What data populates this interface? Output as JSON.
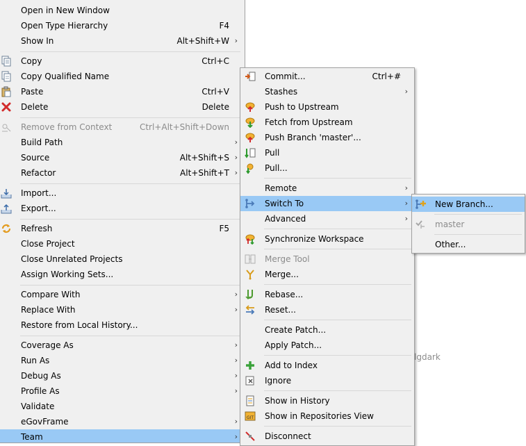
{
  "background_fragment": "lgdark",
  "context_menu": {
    "items": [
      {
        "label": "Open in New Window"
      },
      {
        "label": "Open Type Hierarchy",
        "shortcut": "F4"
      },
      {
        "label": "Show In",
        "shortcut": "Alt+Shift+W"
      },
      {
        "label": "Copy",
        "shortcut": "Ctrl+C"
      },
      {
        "label": "Copy Qualified Name"
      },
      {
        "label": "Paste",
        "shortcut": "Ctrl+V"
      },
      {
        "label": "Delete",
        "shortcut": "Delete"
      },
      {
        "label": "Remove from Context",
        "shortcut": "Ctrl+Alt+Shift+Down"
      },
      {
        "label": "Build Path"
      },
      {
        "label": "Source",
        "shortcut": "Alt+Shift+S"
      },
      {
        "label": "Refactor",
        "shortcut": "Alt+Shift+T"
      },
      {
        "label": "Import..."
      },
      {
        "label": "Export..."
      },
      {
        "label": "Refresh",
        "shortcut": "F5"
      },
      {
        "label": "Close Project"
      },
      {
        "label": "Close Unrelated Projects"
      },
      {
        "label": "Assign Working Sets..."
      },
      {
        "label": "Compare With"
      },
      {
        "label": "Replace With"
      },
      {
        "label": "Restore from Local History..."
      },
      {
        "label": "Coverage As"
      },
      {
        "label": "Run As"
      },
      {
        "label": "Debug As"
      },
      {
        "label": "Profile As"
      },
      {
        "label": "Validate"
      },
      {
        "label": "eGovFrame"
      },
      {
        "label": "Team"
      }
    ]
  },
  "team_menu": {
    "items": [
      {
        "label": "Commit...",
        "shortcut": "Ctrl+#"
      },
      {
        "label": "Stashes"
      },
      {
        "label": "Push to Upstream"
      },
      {
        "label": "Fetch from Upstream"
      },
      {
        "label": "Push Branch 'master'..."
      },
      {
        "label": "Pull"
      },
      {
        "label": "Pull..."
      },
      {
        "label": "Remote"
      },
      {
        "label": "Switch To"
      },
      {
        "label": "Advanced"
      },
      {
        "label": "Synchronize Workspace"
      },
      {
        "label": "Merge Tool"
      },
      {
        "label": "Merge..."
      },
      {
        "label": "Rebase..."
      },
      {
        "label": "Reset..."
      },
      {
        "label": "Create Patch..."
      },
      {
        "label": "Apply Patch..."
      },
      {
        "label": "Add to Index"
      },
      {
        "label": "Ignore"
      },
      {
        "label": "Show in History"
      },
      {
        "label": "Show in Repositories View"
      },
      {
        "label": "Disconnect"
      }
    ]
  },
  "switch_to_menu": {
    "items": [
      {
        "label": "New Branch..."
      },
      {
        "label": "master"
      },
      {
        "label": "Other..."
      }
    ]
  },
  "colors": {
    "menu_background": "#f0f0f0",
    "highlight": "#99c9f5",
    "disabled_text": "#8b8b8b"
  }
}
